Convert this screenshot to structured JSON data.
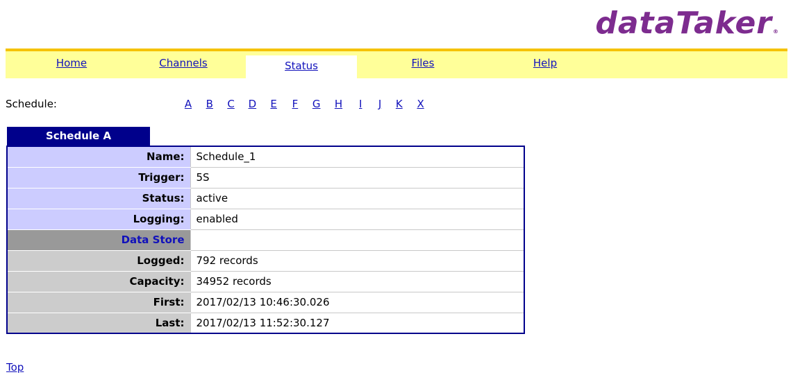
{
  "logo": {
    "text": "dataTaker",
    "reg": "®"
  },
  "nav": {
    "tabs": [
      {
        "label": "Home"
      },
      {
        "label": "Channels"
      },
      {
        "label": "Status",
        "active": true
      },
      {
        "label": "Files"
      },
      {
        "label": "Help"
      }
    ],
    "accent_color": "#ffff99",
    "border_color": "#f5c200"
  },
  "schedule_selector": {
    "label": "Schedule:",
    "letters": [
      "A",
      "B",
      "C",
      "D",
      "E",
      "F",
      "G",
      "H",
      "I",
      "J",
      "K",
      "X"
    ]
  },
  "schedule": {
    "heading": "Schedule A",
    "rows": [
      {
        "label": "Name:",
        "value": "Schedule_1"
      },
      {
        "label": "Trigger:",
        "value": "5S"
      },
      {
        "label": "Status:",
        "value": "active"
      },
      {
        "label": "Logging:",
        "value": "enabled"
      }
    ],
    "data_store": {
      "heading": "Data Store",
      "rows": [
        {
          "label": "Logged:",
          "value": "792 records"
        },
        {
          "label": "Capacity:",
          "value": "34952 records"
        },
        {
          "label": "First:",
          "value": "2017/02/13 10:46:30.026"
        },
        {
          "label": "Last:",
          "value": "2017/02/13 11:52:30.127"
        }
      ]
    }
  },
  "footer": {
    "top_link": "Top"
  }
}
